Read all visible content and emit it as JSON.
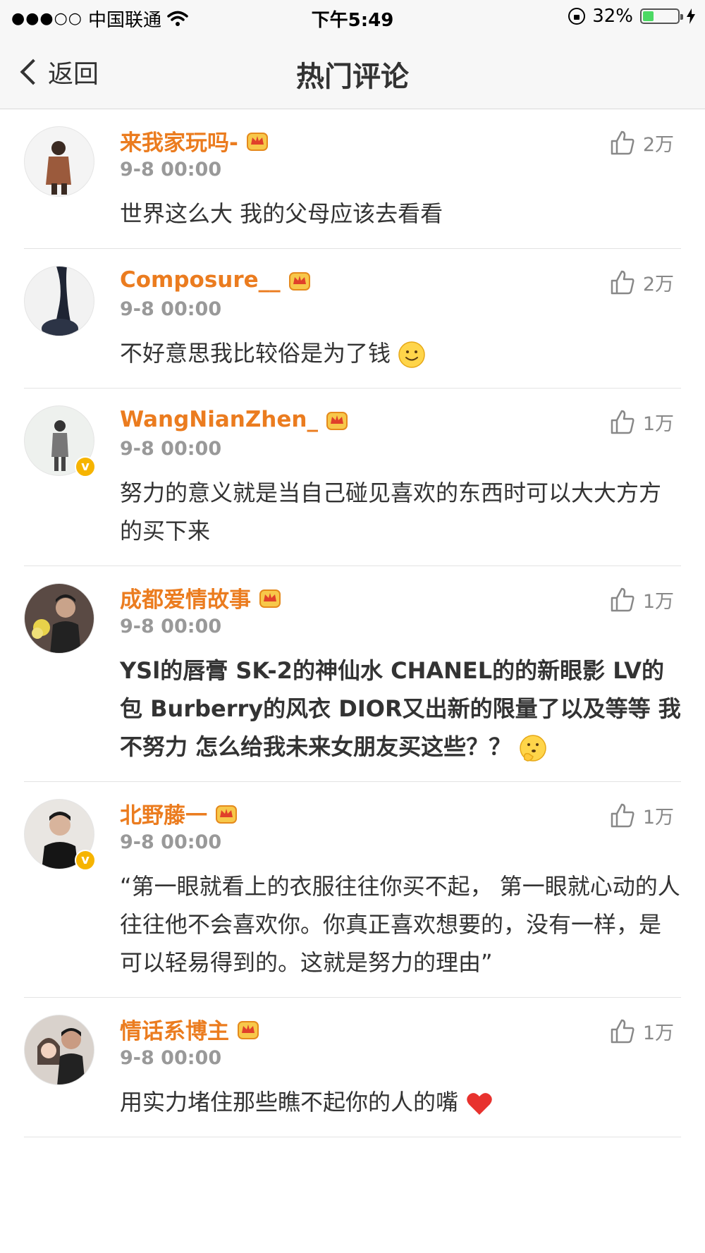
{
  "status_bar": {
    "carrier": "中国联通",
    "signal_dots": "●●●○○",
    "time": "下午5:49",
    "battery": "32%",
    "battery_level": 0.32
  },
  "nav": {
    "back_label": "返回",
    "title": "热门评论"
  },
  "colors": {
    "username": "#eb7c1f",
    "time": "#999999",
    "verified": "#f6b400"
  },
  "comments": [
    {
      "name": "来我家玩吗-",
      "time": "9-8 00:00",
      "likes": "2万",
      "text": "世界这么大 我的父母应该去看看",
      "verified": false
    },
    {
      "name": "Composure__",
      "time": "9-8 00:00",
      "likes": "2万",
      "text": "不好意思我比较俗是为了钱",
      "emoji": "smile-emoji",
      "verified": false
    },
    {
      "name": "WangNianZhen_",
      "time": "9-8 00:00",
      "likes": "1万",
      "text": "努力的意义就是当自己碰见喜欢的东西时可以大大方方的买下来",
      "verified": true
    },
    {
      "name": "成都爱情故事",
      "time": "9-8 00:00",
      "likes": "1万",
      "text": "YSl的唇膏 SK-2的神仙水 CHANEL的的新眼影 LV的包 Burberry的风衣 DIOR又出新的限量了以及等等 我不努力 怎么给我未来女朋友买这些？？",
      "emoji": "thinking-emoji",
      "verified": false
    },
    {
      "name": "北野藤一",
      "time": "9-8 00:00",
      "likes": "1万",
      "text": "“第一眼就看上的衣服往往你买不起， 第一眼就心动的人往往他不会喜欢你。你真正喜欢想要的，没有一样，是可以轻易得到的。这就是努力的理由”",
      "verified": true
    },
    {
      "name": "情话系博主",
      "time": "9-8 00:00",
      "likes": "1万",
      "text": "用实力堵住那些瞧不起你的人的嘴",
      "emoji": "heart-emoji",
      "verified": false
    }
  ]
}
